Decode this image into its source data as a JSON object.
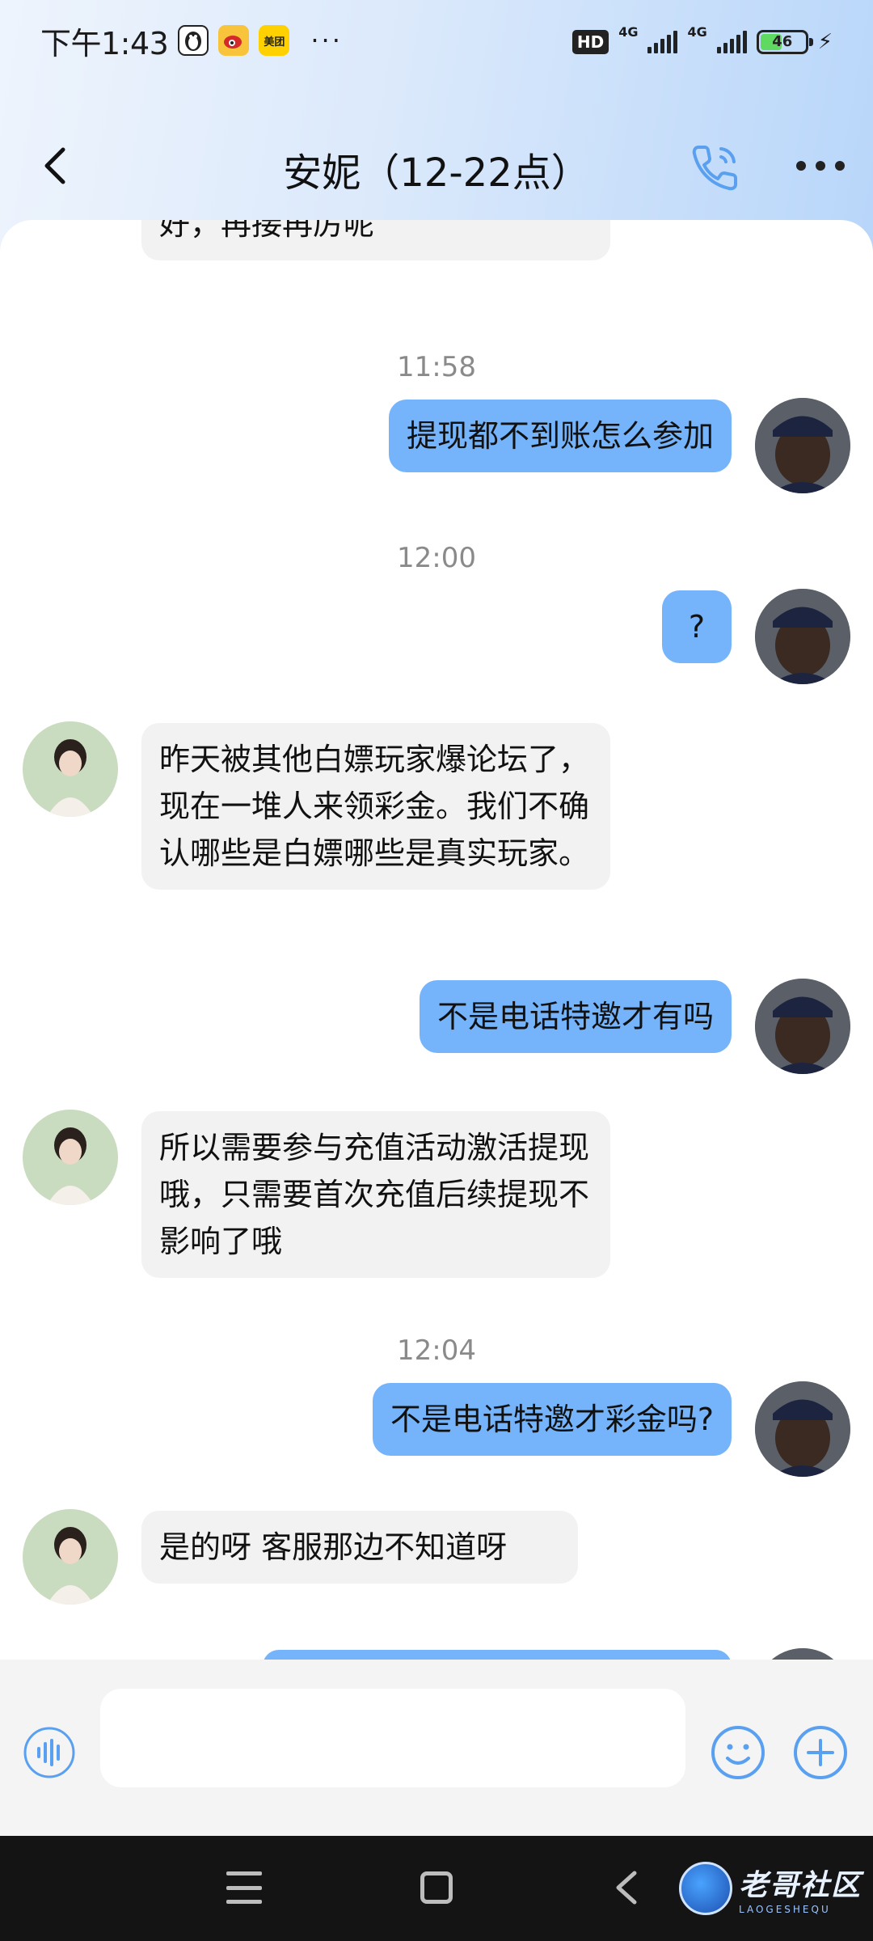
{
  "status_bar": {
    "time": "下午1:43",
    "apps": [
      "penguin-icon",
      "weibo-icon",
      "meituan-icon"
    ],
    "meituan_label": "美团",
    "more": "···",
    "hd_label": "HD",
    "hd_sub": "1|2",
    "net1": "4G",
    "net2": "4G",
    "battery": "46"
  },
  "title_bar": {
    "title": "安妮（12-22点）"
  },
  "messages": [
    {
      "type": "in",
      "text": "好，再接再厉呢",
      "partial": true
    },
    {
      "type": "time",
      "text": "11:58"
    },
    {
      "type": "out",
      "text": "提现都不到账怎么参加"
    },
    {
      "type": "time",
      "text": "12:00"
    },
    {
      "type": "out",
      "text": "?"
    },
    {
      "type": "in",
      "text": " 昨天被其他白嫖玩家爆论坛了，现在一堆人来领彩金。我们不确认哪些是白嫖哪些是真实玩家。"
    },
    {
      "type": "out",
      "text": "不是电话特邀才有吗"
    },
    {
      "type": "in",
      "text": "所以需要参与充值活动激活提现哦，只需要首次充值后续提现不影响了哦"
    },
    {
      "type": "time",
      "text": "12:04"
    },
    {
      "type": "out",
      "text": "不是电话特邀才彩金吗?"
    },
    {
      "type": "in",
      "text": "是的呀  客服那边不知道呀"
    }
  ],
  "input_bar": {
    "placeholder": ""
  },
  "watermark": {
    "cn": "老哥社区",
    "en": "LAOGESHEQU"
  },
  "colors": {
    "out_bubble": "#75b4fb",
    "in_bubble": "#f2f2f2",
    "accent": "#4a90e2"
  }
}
